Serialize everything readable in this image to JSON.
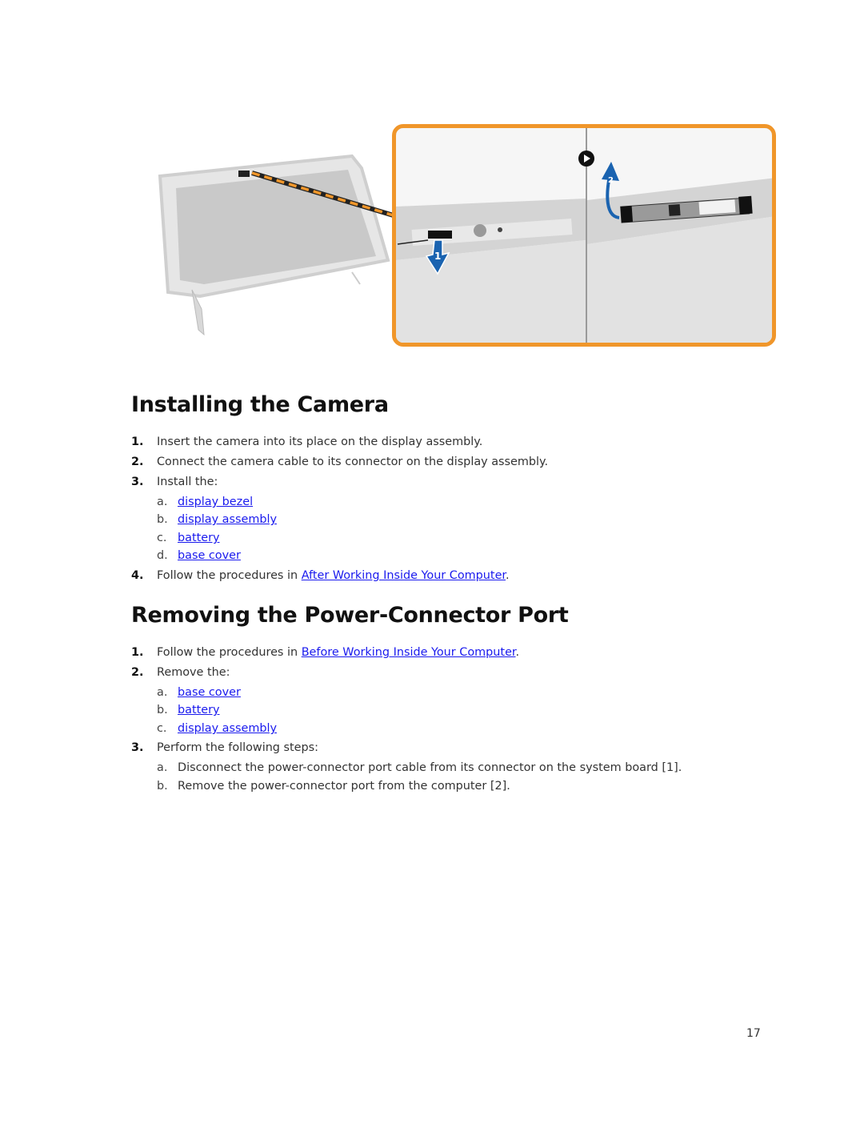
{
  "figure": {
    "overview_image": "display-assembly-overview",
    "detail_images": [
      "camera-cable-disconnect",
      "camera-module-lift"
    ],
    "callouts": [
      "1",
      "2"
    ],
    "accent_color": "#f0962a",
    "arrow_color": "#1a63b0"
  },
  "section_install": {
    "title": "Installing the Camera",
    "steps": [
      {
        "num": "1.",
        "text": "Insert the camera into its place on the display assembly."
      },
      {
        "num": "2.",
        "text": "Connect the camera cable to its connector on the display assembly."
      },
      {
        "num": "3.",
        "text": "Install the:",
        "sub": [
          {
            "letter": "a.",
            "link": "display bezel"
          },
          {
            "letter": "b.",
            "link": "display assembly"
          },
          {
            "letter": "c.",
            "link": "battery"
          },
          {
            "letter": "d.",
            "link": "base cover"
          }
        ]
      },
      {
        "num": "4.",
        "text": "Follow the procedures in ",
        "link": "After Working Inside Your Computer",
        "after": "."
      }
    ]
  },
  "section_remove": {
    "title": "Removing the Power-Connector Port",
    "steps": [
      {
        "num": "1.",
        "text": "Follow the procedures in ",
        "link": "Before Working Inside Your Computer",
        "after": "."
      },
      {
        "num": "2.",
        "text": "Remove the:",
        "sub": [
          {
            "letter": "a.",
            "link": "base cover"
          },
          {
            "letter": "b.",
            "link": "battery"
          },
          {
            "letter": "c.",
            "link": "display assembly"
          }
        ]
      },
      {
        "num": "3.",
        "text": "Perform the following steps:",
        "sub": [
          {
            "letter": "a.",
            "text": "Disconnect the power-connector port cable from its connector on the system board [1]."
          },
          {
            "letter": "b.",
            "text": "Remove the power-connector port from the computer [2]."
          }
        ]
      }
    ]
  },
  "page_number": "17"
}
